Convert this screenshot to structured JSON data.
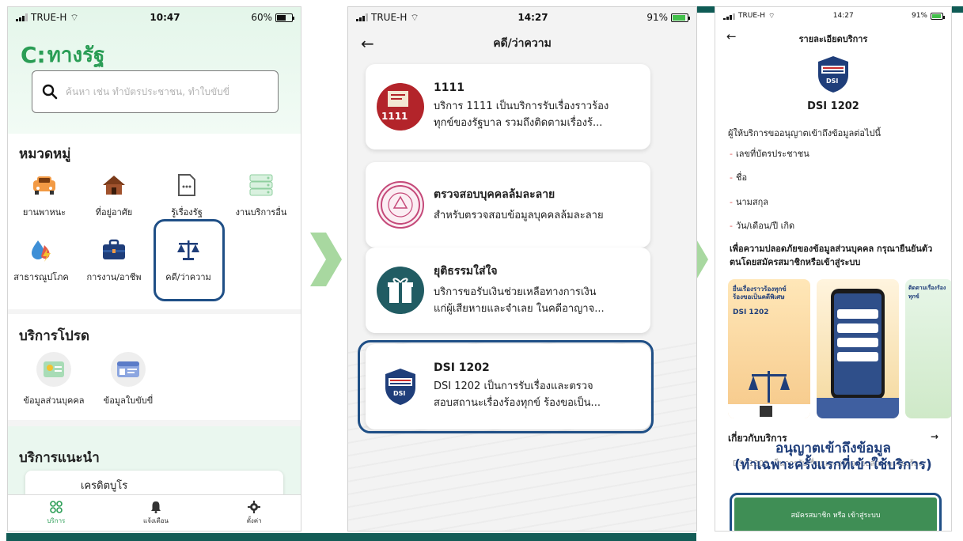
{
  "screen1": {
    "status": {
      "carrier": "TRUE-H",
      "time": "10:47",
      "battery": "60%",
      "battery_level": 0.6
    },
    "logo_text": "ทางรัฐ",
    "search_placeholder": "ค้นหา เช่น ทำบัตรประชาชน, ทำใบขับขี่",
    "categories_title": "หมวดหมู่",
    "categories": [
      {
        "label": "ยานพาหนะ",
        "icon": "car-icon",
        "color": "#f29a44"
      },
      {
        "label": "ที่อยู่อาศัย",
        "icon": "house-icon",
        "color": "#a0522d"
      },
      {
        "label": "รู้เรื่องรัฐ",
        "icon": "document-icon",
        "color": "#5a5a5a"
      },
      {
        "label": "งานบริการอื่น",
        "icon": "server-icon",
        "color": "#8fcf9f"
      },
      {
        "label": "สาธารณูปโภค",
        "icon": "utility-icon",
        "color": "#e25a4a"
      },
      {
        "label": "การงาน/อาชีพ",
        "icon": "briefcase-icon",
        "color": "#1f3e7a"
      },
      {
        "label": "คดี/ว่าความ",
        "icon": "scales-icon",
        "color": "#1f3e7a"
      }
    ],
    "favorites_title": "บริการโปรด",
    "favorites": [
      {
        "label": "ข้อมูลส่วนบุคคล",
        "icon": "id-card-icon"
      },
      {
        "label": "ข้อมูลใบขับขี่",
        "icon": "driver-license-icon"
      }
    ],
    "recommended_title": "บริการแนะนำ",
    "recommended_item": "เครดิตบูโร",
    "tabs": [
      {
        "label": "บริการ",
        "icon": "grid-icon",
        "active": true
      },
      {
        "label": "แจ้งเตือน",
        "icon": "bell-icon",
        "active": false
      },
      {
        "label": "ตั้งค่า",
        "icon": "gear-icon",
        "active": false
      }
    ]
  },
  "screen2": {
    "status": {
      "carrier": "TRUE-H",
      "time": "14:27",
      "battery": "91%",
      "battery_level": 0.91
    },
    "title": "คดี/ว่าความ",
    "services": [
      {
        "title": "1111",
        "desc1": "บริการ 1111 เป็นบริการรับเรื่องราวร้อง",
        "desc2": "ทุกข์ของรัฐบาล รวมถึงติดตามเรื่องร้...",
        "icon": "1111-logo-icon"
      },
      {
        "title": "ตรวจสอบบุคคลล้มละลาย",
        "desc1": "สำหรับตรวจสอบข้อมูลบุคคลล้มละลาย",
        "desc2": "",
        "icon": "bankruptcy-seal-icon"
      },
      {
        "title": "ยุติธรรมใส่ใจ",
        "desc1": "บริการขอรับเงินช่วยเหลือทางการเงิน",
        "desc2": "แก่ผู้เสียหายและจำเลย ในคดีอาญาจ...",
        "icon": "justice-gift-icon"
      },
      {
        "title": "DSI 1202",
        "desc1": "DSI 1202 เป็นการรับเรื่องและตรวจ",
        "desc2": "สอบสถานะเรื่องร้องทุกข์ ร้องขอเป็น...",
        "icon": "dsi-emblem-icon"
      }
    ]
  },
  "screen3": {
    "status": {
      "carrier": "TRUE-H",
      "time": "14:27",
      "battery": "91%",
      "battery_level": 0.91
    },
    "title": "รายละเอียดบริการ",
    "service_name": "DSI 1202",
    "intro": "ผู้ให้บริการขออนุญาตเข้าถึงข้อมูลต่อไปนี้",
    "requirements": [
      "เลขที่บัตรประชาชน",
      "ชื่อ",
      "นามสกุล",
      "วัน/เดือน/ปี เกิด"
    ],
    "note": "เพื่อความปลอดภัยของข้อมูลส่วนบุคคล กรุณายืนยันตัวตนโดยสมัครสมาชิกหรือเข้าสู่ระบบ",
    "promo1_title": "ยื่นเรื่องราวร้องทุกข์ ร้องขอเป็นคดีพิเศษ",
    "promo1_sub": "DSI 1202",
    "promo3_title": "ติดตามเรื่องร้องทุกข์",
    "about_title": "เกี่ยวกับบริการ",
    "about_desc": "DSI 1202 เป็นการรับเรื่องและตรวจสอบสถานะเรื่องร้อง",
    "overlay_line1": "อนุญาตเข้าถึงข้อมูล",
    "overlay_line2": "(ทำเฉพาะครั้งแรกที่เข้าใช้บริการ)",
    "register_button": "สมัครสมาชิก หรือ เข้าสู่ระบบ"
  },
  "colors": {
    "brand_green": "#2a9d55",
    "highlight_navy": "#1f4f86",
    "arrow_green": "#a8d8a0",
    "button_green": "#3f8e55",
    "footer_teal": "#135c56"
  }
}
